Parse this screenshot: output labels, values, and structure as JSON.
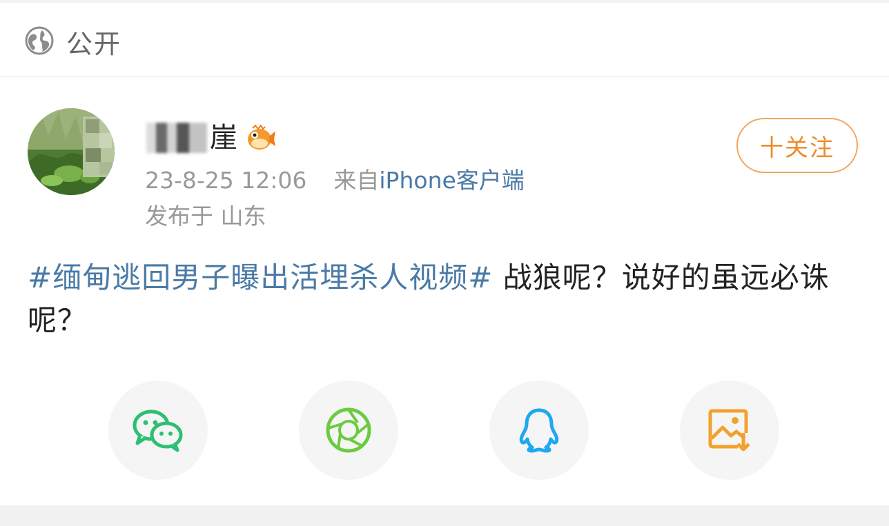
{
  "visibility": {
    "icon": "globe-icon",
    "label": "公开"
  },
  "post": {
    "author": {
      "name_visible_part": "崖",
      "badge_icon": "fish-badge-icon",
      "avatar": "plant-photo-avatar"
    },
    "time": "23-8-25 12:06",
    "source_prefix": "来自",
    "source_client": "iPhone客户端",
    "location_label": "发布于 山东",
    "follow_button": "十关注",
    "topic": "#缅甸逃回男子曝出活埋杀人视频#",
    "body": " 战狼呢？说好的虽远必诛呢？"
  },
  "share": [
    {
      "name": "wechat",
      "icon": "wechat-icon",
      "color": "#2dbf73"
    },
    {
      "name": "moments",
      "icon": "moments-shutter-icon",
      "color": "#6bcb3f"
    },
    {
      "name": "qq",
      "icon": "qq-penguin-icon",
      "color": "#1ea8f0"
    },
    {
      "name": "save-image",
      "icon": "save-image-icon",
      "color": "#f3a12d"
    }
  ],
  "colors": {
    "link": "#4a7aa6",
    "accent": "#ee8b2c",
    "muted": "#999999"
  }
}
